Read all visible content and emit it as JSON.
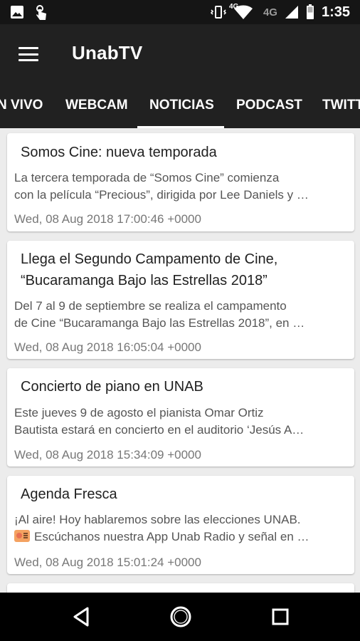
{
  "status_bar": {
    "time": "1:35",
    "network_4g_small": "4G",
    "network_4g": "4G",
    "icons": [
      "image-icon",
      "touch-icon",
      "vibrate-icon",
      "wifi-icon",
      "signal-icon",
      "battery-icon"
    ]
  },
  "app_bar": {
    "title": "UnabTV",
    "menu_icon": "hamburger-icon"
  },
  "tabs": [
    {
      "label": "EN VIVO",
      "display": "N VIVO"
    },
    {
      "label": "WEBCAM",
      "display": "WEBCAM"
    },
    {
      "label": "NOTICIAS",
      "display": "NOTICIAS",
      "selected": true
    },
    {
      "label": "PODCAST",
      "display": "PODCAST"
    },
    {
      "label": "TWITTER",
      "display": "TWITT"
    }
  ],
  "articles": [
    {
      "title_lines": [
        "Somos Cine: nueva temporada"
      ],
      "summary_lines": [
        "La tercera temporada de “Somos Cine” comienza",
        "con la película “Precious”, dirigida por Lee Daniels y …"
      ],
      "date": "Wed, 08 Aug 2018 17:00:46 +0000"
    },
    {
      "title_lines": [
        "Llega el Segundo Campamento de Cine,",
        "“Bucaramanga Bajo las Estrellas 2018”"
      ],
      "summary_lines": [
        "Del 7 al 9 de septiembre se realiza el campamento",
        "de Cine “Bucaramanga Bajo las Estrellas 2018”, en …"
      ],
      "date": "Wed, 08 Aug 2018 16:05:04 +0000"
    },
    {
      "title_lines": [
        "Concierto de piano en UNAB"
      ],
      "summary_lines": [
        "Este jueves 9 de agosto el pianista Omar Ortiz",
        "Bautista estará en concierto en el auditorio ‘Jesús A…"
      ],
      "date": "Wed, 08 Aug 2018 15:34:09 +0000"
    },
    {
      "title_lines": [
        "Agenda Fresca"
      ],
      "summary_lines": [
        "¡Al aire! Hoy hablaremos sobre las elecciones UNAB.",
        "Escúchanos nuestra App Unab Radio y señal en …"
      ],
      "summary_emoji": "radio-icon",
      "date": "Wed, 08 Aug 2018 15:01:24 +0000"
    }
  ],
  "nav_bar": {
    "buttons": [
      "back-icon",
      "home-icon",
      "recent-apps-icon"
    ]
  },
  "colors": {
    "app_bar": "#212121",
    "status_bar": "#151515",
    "background": "#ececec",
    "card": "#ffffff"
  }
}
